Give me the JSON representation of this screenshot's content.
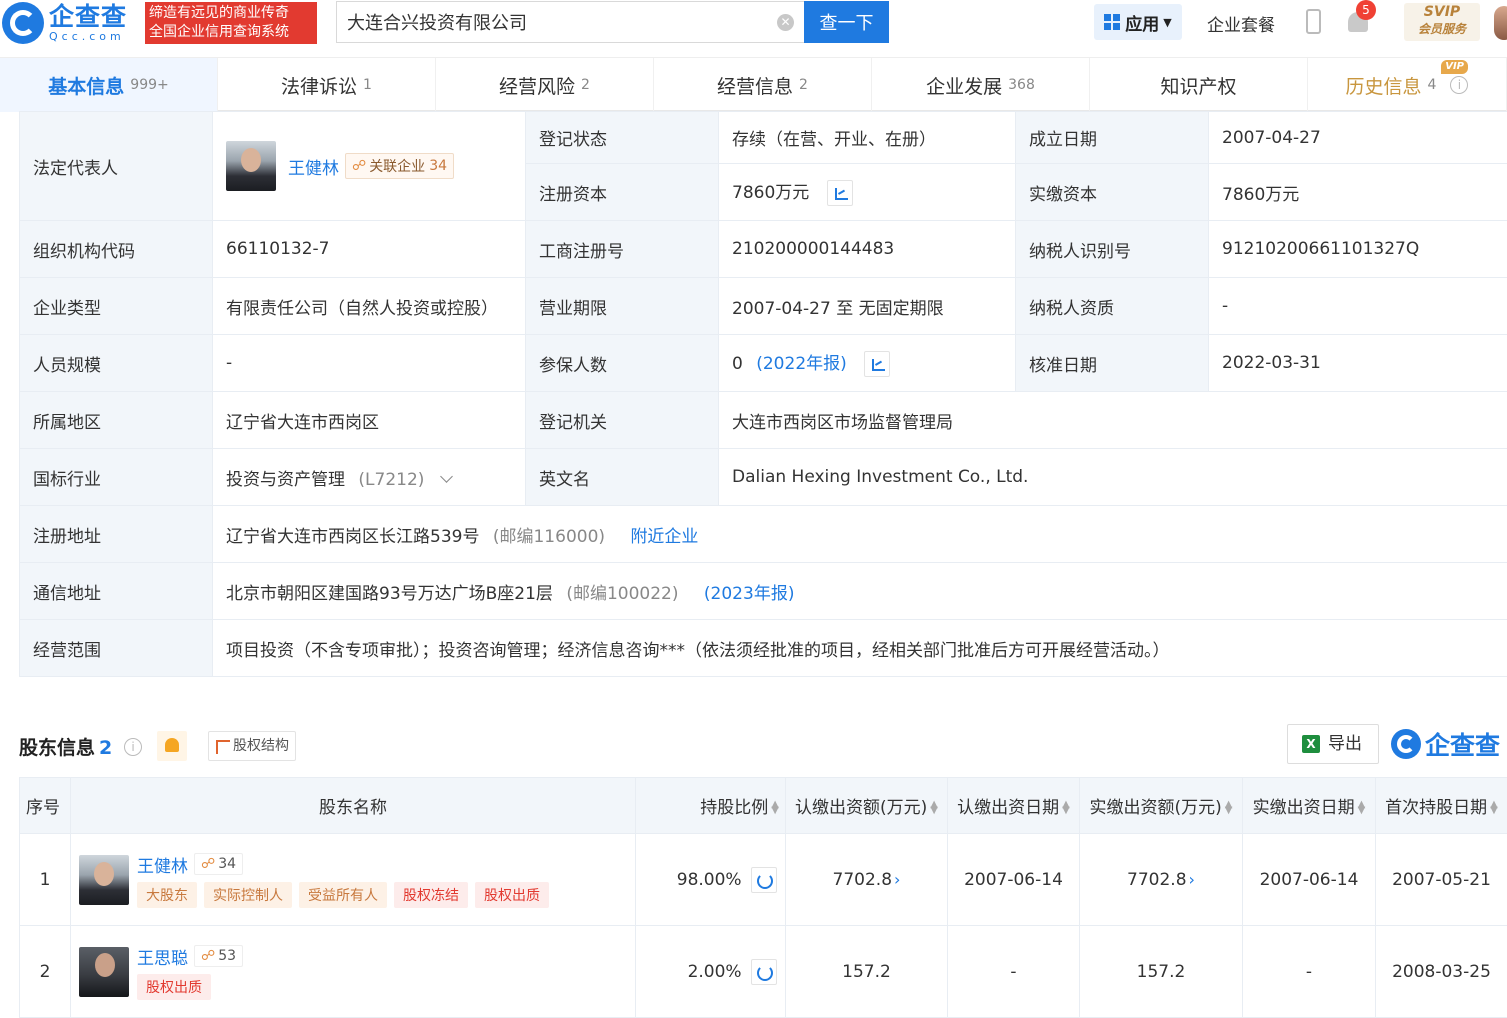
{
  "header": {
    "logo_cn": "企查查",
    "logo_en": "Qcc.com",
    "slogan_line1": "缔造有远见的商业传奇",
    "slogan_line2": "全国企业信用查询系统",
    "search_value": "大连合兴投资有限公司",
    "search_button": "查一下",
    "app_label": "应用",
    "package_label": "企业套餐",
    "notification_count": "5",
    "svip_line1": "SVIP",
    "svip_line2": "会员服务"
  },
  "tabs": [
    {
      "label": "基本信息",
      "count": "999+"
    },
    {
      "label": "法律诉讼",
      "count": "1"
    },
    {
      "label": "经营风险",
      "count": "2"
    },
    {
      "label": "经营信息",
      "count": "2"
    },
    {
      "label": "企业发展",
      "count": "368"
    },
    {
      "label": "知识产权",
      "count": ""
    },
    {
      "label": "历史信息",
      "count": "4",
      "badge": "VIP"
    }
  ],
  "info": {
    "legal_rep_label": "法定代表人",
    "legal_rep_name": "王健林",
    "legal_rep_rel_label": "关联企业",
    "legal_rep_rel_count": "34",
    "reg_status_label": "登记状态",
    "reg_status": "存续（在营、开业、在册）",
    "founded_label": "成立日期",
    "founded": "2007-04-27",
    "reg_capital_label": "注册资本",
    "reg_capital": "7860万元",
    "paid_capital_label": "实缴资本",
    "paid_capital": "7860万元",
    "org_code_label": "组织机构代码",
    "org_code": "66110132-7",
    "biz_reg_no_label": "工商注册号",
    "biz_reg_no": "210200000144483",
    "tax_id_label": "纳税人识别号",
    "tax_id": "91210200661101327Q",
    "company_type_label": "企业类型",
    "company_type": "有限责任公司（自然人投资或控股）",
    "term_label": "营业期限",
    "term": "2007-04-27 至 无固定期限",
    "taxpayer_qual_label": "纳税人资质",
    "taxpayer_qual": "-",
    "staff_size_label": "人员规模",
    "staff_size": "-",
    "insured_label": "参保人数",
    "insured": "0",
    "insured_year": "(2022年报)",
    "approved_label": "核准日期",
    "approved": "2022-03-31",
    "region_label": "所属地区",
    "region": "辽宁省大连市西岗区",
    "authority_label": "登记机关",
    "authority": "大连市西岗区市场监督管理局",
    "industry_label": "国标行业",
    "industry": "投资与资产管理",
    "industry_code": "(L7212)",
    "english_name_label": "英文名",
    "english_name": "Dalian Hexing Investment Co., Ltd.",
    "reg_address_label": "注册地址",
    "reg_address": "辽宁省大连市西岗区长江路539号",
    "reg_postcode": "(邮编116000)",
    "nearby_link": "附近企业",
    "mail_address_label": "通信地址",
    "mail_address": "北京市朝阳区建国路93号万达广场B座21层",
    "mail_postcode": "(邮编100022)",
    "mail_year": "(2023年报)",
    "scope_label": "经营范围",
    "scope": "项目投资（不含专项审批）；投资咨询管理；经济信息咨询***（依法须经批准的项目，经相关部门批准后方可开展经营活动。）"
  },
  "shareholders": {
    "title": "股东信息",
    "count": "2",
    "structure_label": "股权结构",
    "export_label": "导出",
    "brand_logo": "企查查",
    "columns": [
      "序号",
      "股东名称",
      "持股比例",
      "认缴出资额(万元)",
      "认缴出资日期",
      "实缴出资额(万元)",
      "实缴出资日期",
      "首次持股日期"
    ],
    "rows": [
      {
        "index": "1",
        "name": "王健林",
        "rel_count": "34",
        "tags": [
          "大股东",
          "实际控制人",
          "受益所有人",
          "股权冻结",
          "股权出质"
        ],
        "ratio": "98.00%",
        "subscribed": "7702.8",
        "subscribed_date": "2007-06-14",
        "paid": "7702.8",
        "paid_date": "2007-06-14",
        "first_hold_date": "2007-05-21"
      },
      {
        "index": "2",
        "name": "王思聪",
        "rel_count": "53",
        "tags": [
          "股权出质"
        ],
        "ratio": "2.00%",
        "subscribed": "157.2",
        "subscribed_date": "-",
        "paid": "157.2",
        "paid_date": "-",
        "first_hold_date": "2008-03-25"
      }
    ]
  }
}
